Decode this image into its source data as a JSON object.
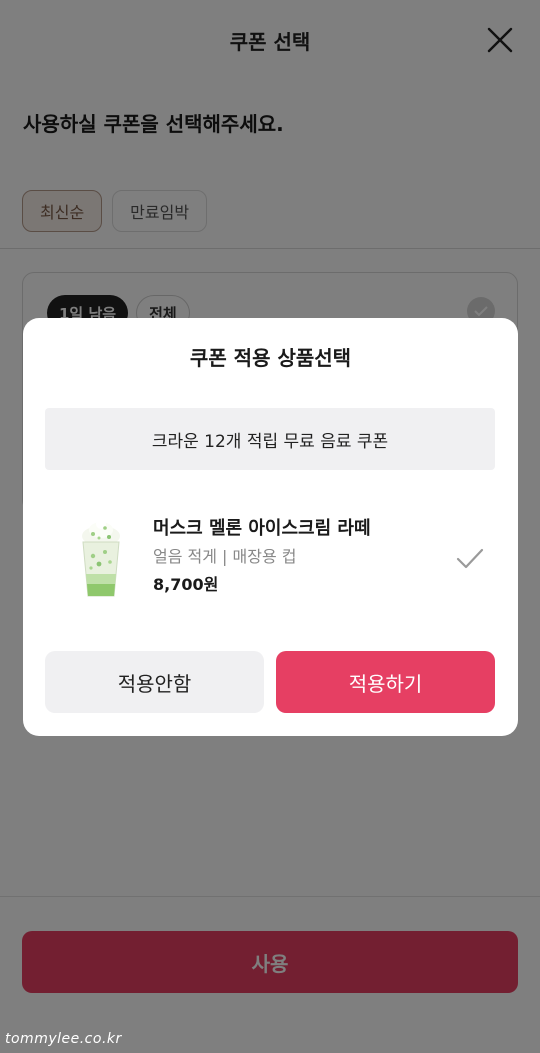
{
  "header": {
    "title": "쿠폰 선택"
  },
  "page": {
    "heading": "사용하실 쿠폰을 선택해주세요."
  },
  "sort": {
    "options": [
      "최신순",
      "만료임박"
    ],
    "selected": "최신순"
  },
  "coupon_card": {
    "tags": [
      "1일 남음",
      "전체"
    ]
  },
  "bottom": {
    "use_label": "사용"
  },
  "modal": {
    "title": "쿠폰 적용 상품선택",
    "coupon_name": "크라운 12개 적립 무료 음료 쿠폰",
    "product": {
      "name": "머스크 멜론 아이스크림 라떼",
      "option": "얼음 적게 | 매장용 컵",
      "price": "8,700원",
      "selected": true
    },
    "cancel_label": "적용안함",
    "apply_label": "적용하기"
  },
  "watermark": "tommylee.co.kr",
  "colors": {
    "accent": "#e63f63",
    "overlay": "rgba(0,0,0,0.5)",
    "chip_active_bg": "#f6eee8"
  },
  "icons": {
    "close": "close-icon",
    "check": "check-icon"
  }
}
